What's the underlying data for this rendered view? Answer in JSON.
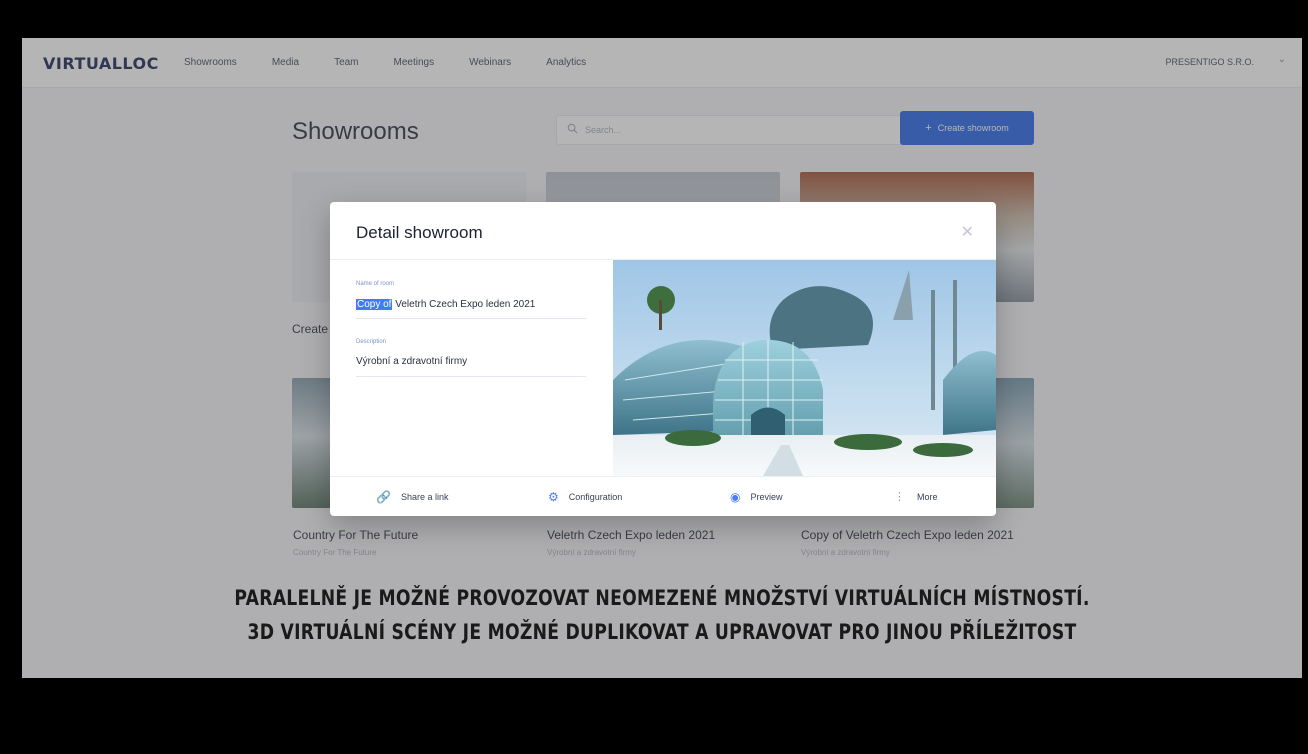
{
  "app": {
    "logo": "VIRTUALLOC",
    "nav": [
      "Showrooms",
      "Media",
      "Team",
      "Meetings",
      "Webinars",
      "Analytics"
    ],
    "company": "PRESENTIGO S.R.O."
  },
  "page": {
    "title": "Showrooms",
    "search_placeholder": "Search...",
    "create_button": "Create showroom"
  },
  "cards": [
    {
      "title": "Create",
      "subtitle": ""
    },
    {
      "title": "Country For The Future",
      "subtitle": "Country For The Future"
    },
    {
      "title": "Veletrh Czech Expo leden 2021",
      "subtitle": "Výrobní a zdravotní firmy"
    },
    {
      "title": "Copy of Veletrh Czech Expo leden 2021",
      "subtitle": "Výrobní a zdravotní firmy"
    }
  ],
  "modal": {
    "title": "Detail showroom",
    "name_label": "Name of room",
    "name_selected": "Copy of",
    "name_rest": " Veletrh Czech Expo leden 2021",
    "description_label": "Description",
    "description_value": "Výrobní a zdravotní firmy",
    "actions": [
      "Share a link",
      "Configuration",
      "Preview",
      "More"
    ]
  },
  "caption": {
    "line1": "PARALELNĚ JE MOŽNÉ PROVOZOVAT NEOMEZENÉ MNOŽSTVÍ VIRTUÁLNÍCH MÍSTNOSTÍ.",
    "line2": "3D VIRTUÁLNÍ SCÉNY JE MOŽNÉ DUPLIKOVAT A UPRAVOVAT PRO JINOU PŘÍLEŽITOST"
  },
  "colors": {
    "accent": "#1e5eea",
    "selection": "#3b7ff5"
  }
}
